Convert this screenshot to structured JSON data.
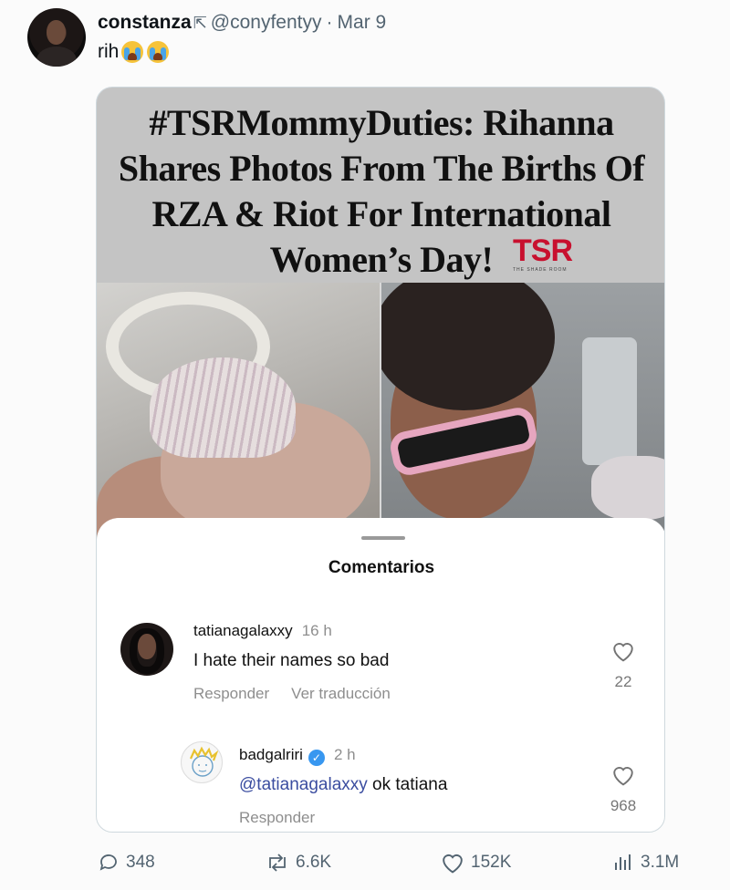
{
  "tweet": {
    "display_name": "constanza",
    "bot_icon": "automated-label-icon",
    "handle": "@conyfentyy",
    "separator": "·",
    "date": "Mar 9",
    "text": "rih",
    "emojis": [
      "loudly-crying-face",
      "loudly-crying-face"
    ]
  },
  "media": {
    "headline": "#TSRMommyDuties: Rihanna Shares Photos From The Births Of RZA & Riot For International Women’s Day!",
    "logo_text": "TSR",
    "logo_tagline": "THE SHADE ROOM",
    "comments_sheet": {
      "title": "Comentarios",
      "comments": [
        {
          "user": "tatianagalaxxy",
          "time": "16 h",
          "text": "I hate their names so bad",
          "reply_label": "Responder",
          "translate_label": "Ver traducción",
          "likes": "22"
        },
        {
          "user": "badgalriri",
          "verified": true,
          "time": "2 h",
          "mention": "@tatianagalaxxy",
          "text": "ok tatiana",
          "reply_label": "Responder",
          "likes": "968"
        }
      ]
    }
  },
  "actions": {
    "replies": "348",
    "reposts": "6.6K",
    "likes": "152K",
    "views": "3.1M"
  },
  "colors": {
    "secondary_text": "#536471",
    "logo_red": "#c8102e",
    "verified_blue": "#3897f0"
  }
}
